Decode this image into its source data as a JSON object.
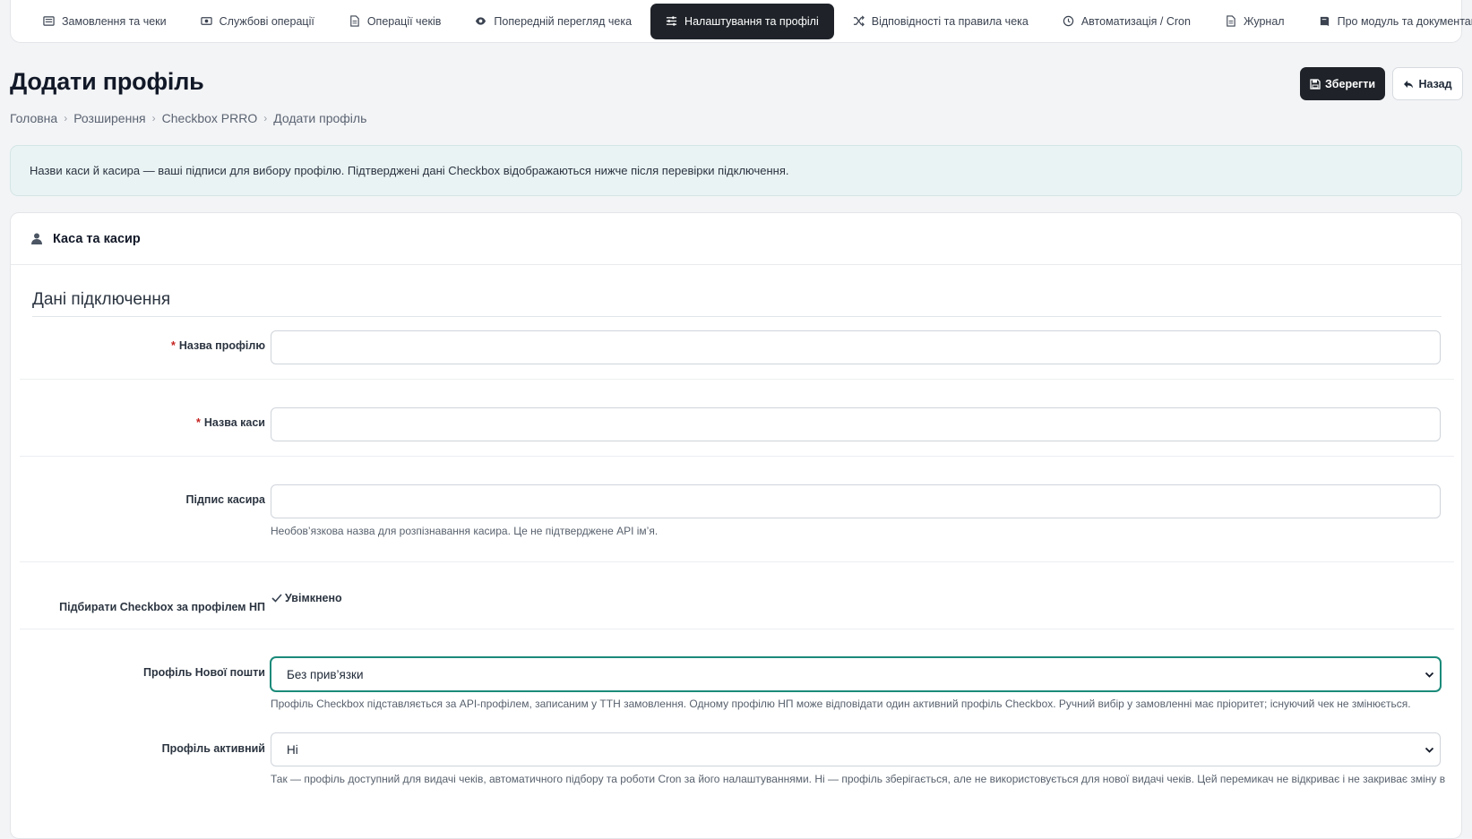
{
  "nav": {
    "tabs": [
      {
        "label": "Замовлення та чеки",
        "icon": "list-icon"
      },
      {
        "label": "Службові операції",
        "icon": "cash-icon"
      },
      {
        "label": "Операції чеків",
        "icon": "file-icon"
      },
      {
        "label": "Попередній перегляд чека",
        "icon": "eye-icon"
      },
      {
        "label": "Налаштування та профілі",
        "icon": "sliders-icon",
        "active": true
      },
      {
        "label": "Відповідності та правила чека",
        "icon": "shuffle-icon"
      },
      {
        "label": "Автоматизація / Cron",
        "icon": "clock-icon"
      },
      {
        "label": "Журнал",
        "icon": "file-icon"
      },
      {
        "label": "Про модуль та документація",
        "icon": "book-icon"
      }
    ]
  },
  "header": {
    "title": "Додати профіль",
    "save_label": "Зберегти",
    "back_label": "Назад"
  },
  "breadcrumb": [
    "Головна",
    "Розширення",
    "Checkbox PRRO",
    "Додати профіль"
  ],
  "alert": {
    "text": "Назви каси й касира — ваші підписи для вибору профілю. Підтверджені дані Checkbox відображаються нижче після перевірки підключення."
  },
  "card": {
    "title": "Каса та касир",
    "legend": "Дані підключення",
    "fields": {
      "profile_name": {
        "label": "Назва профілю",
        "required": "*",
        "value": ""
      },
      "cash_name": {
        "label": "Назва каси",
        "required": "*",
        "value": ""
      },
      "cashier_signature": {
        "label": "Підпис касира",
        "value": "",
        "help": "Необов’язкова назва для розпізнавання касира. Це не підтверджене API ім’я."
      },
      "match_np": {
        "label": "Підбирати Checkbox за профілем НП",
        "checkbox_label": "Увімкнено",
        "checked": true
      },
      "np_profile": {
        "label": "Профіль Нової пошти",
        "selected": "Без прив’язки",
        "help": "Профіль Checkbox підставляється за API-профілем, записаним у ТТН замовлення. Одному профілю НП може відповідати один активний профіль Checkbox. Ручний вибір у замовленні має пріоритет; існуючий чек не змінюється."
      },
      "profile_active": {
        "label": "Профіль активний",
        "selected": "Ні",
        "help": "Так — профіль доступний для видачі чеків, автоматичного підбору та роботи Cron за його налаштуваннями. Ні — профіль зберігається, але не використовується для нової видачі чеків. Цей перемикач не відкриває і не закриває зміну в"
      }
    }
  },
  "colors": {
    "active_tab": "#1f2329",
    "alert_bg": "#eaf3f3",
    "focus": "#1b8a7a",
    "required": "#c5221f"
  }
}
